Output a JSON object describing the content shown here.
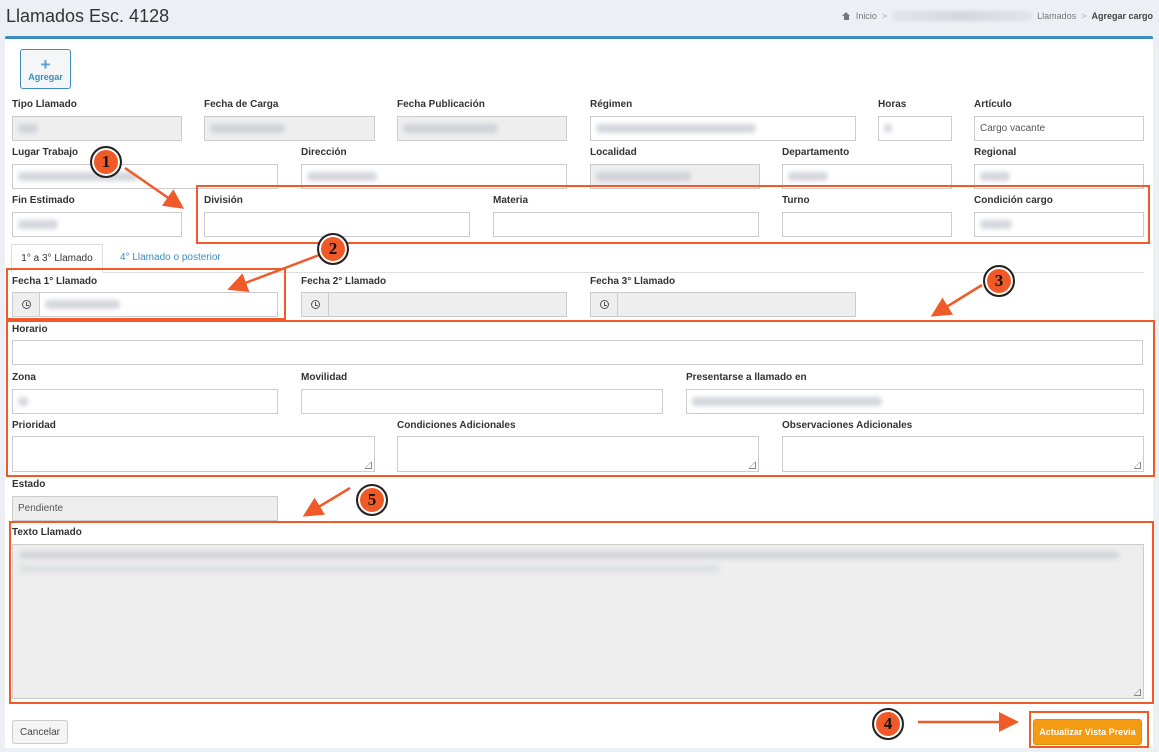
{
  "header": {
    "title": "Llamados Esc. 4128",
    "breadcrumb": {
      "home": "Inicio",
      "llamados": "Llamados",
      "current": "Agregar cargo"
    }
  },
  "toolbar": {
    "add_label": "Agregar"
  },
  "fields": {
    "tipo_llamado": "Tipo Llamado",
    "fecha_carga": "Fecha de Carga",
    "fecha_publicacion": "Fecha Publicación",
    "regimen": "Régimen",
    "horas": "Horas",
    "articulo": "Artículo",
    "articulo_value": "Cargo vacante",
    "lugar_trabajo": "Lugar Trabajo",
    "direccion": "Dirección",
    "localidad": "Localidad",
    "departamento": "Departamento",
    "regional": "Regional",
    "fin_estimado": "Fin Estimado",
    "division": "División",
    "materia": "Materia",
    "turno": "Turno",
    "condicion_cargo": "Condición cargo",
    "fecha_1": "Fecha 1° Llamado",
    "fecha_2": "Fecha 2° Llamado",
    "fecha_3": "Fecha 3° Llamado",
    "horario": "Horario",
    "zona": "Zona",
    "movilidad": "Movilidad",
    "presentarse": "Presentarse a llamado en",
    "prioridad": "Prioridad",
    "condiciones_adicionales": "Condiciones Adicionales",
    "observaciones_adicionales": "Observaciones Adicionales",
    "estado": "Estado",
    "estado_value": "Pendiente",
    "texto_llamado": "Texto Llamado"
  },
  "tabs": [
    {
      "label": "1° a 3° Llamado",
      "active": true
    },
    {
      "label": "4° Llamado o posterior",
      "active": false
    }
  ],
  "buttons": {
    "cancel": "Cancelar",
    "preview": "Actualizar Vista Previa"
  },
  "annotations": [
    "1",
    "2",
    "3",
    "4",
    "5"
  ],
  "colors": {
    "accent": "#3c8dbc",
    "highlight": "#f05a28",
    "warning": "#f39c12"
  }
}
